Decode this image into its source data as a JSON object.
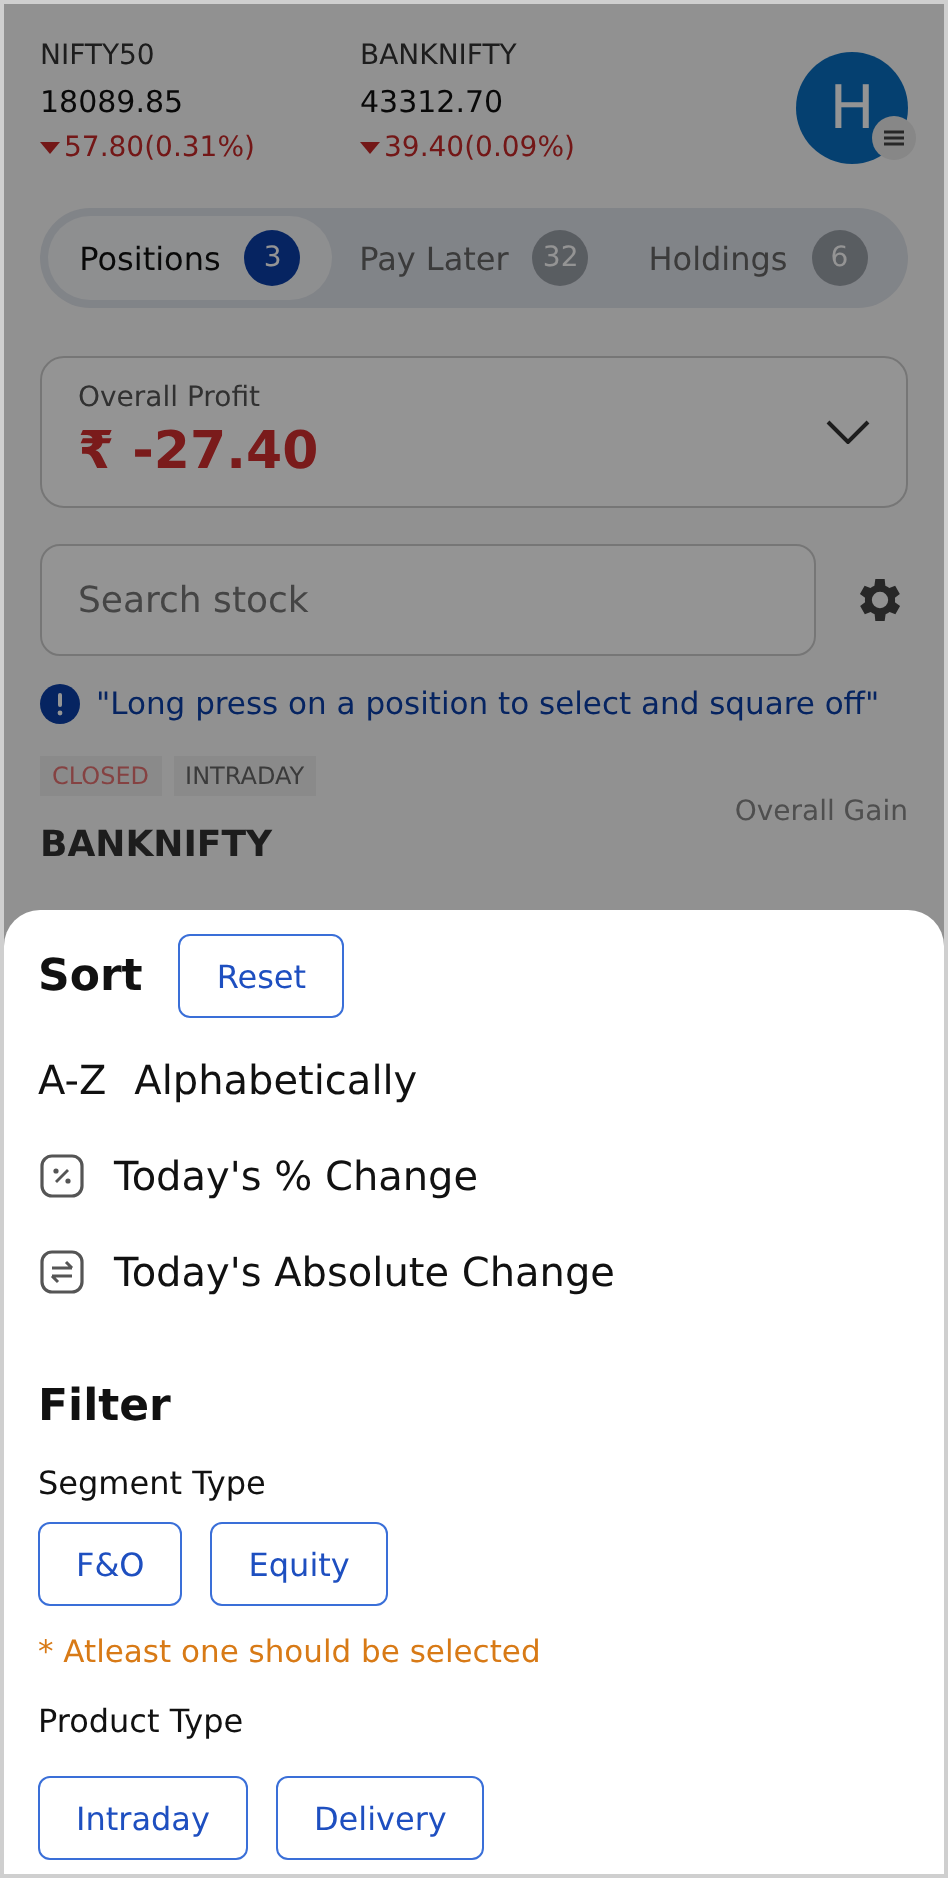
{
  "indices": [
    {
      "name": "NIFTY50",
      "value": "18089.85",
      "change": "57.80(0.31%)",
      "falling": true
    },
    {
      "name": "BANKNIFTY",
      "value": "43312.70",
      "change": "39.40(0.09%)",
      "falling": true
    }
  ],
  "avatar": {
    "initial": "H"
  },
  "tabs": [
    {
      "label": "Positions",
      "count": "3",
      "selected": true
    },
    {
      "label": "Pay Later",
      "count": "32",
      "selected": false
    },
    {
      "label": "Holdings",
      "count": "6",
      "selected": false
    }
  ],
  "overall_profit": {
    "label": "Overall Profit",
    "value": "₹ -27.40",
    "expanded": false
  },
  "search": {
    "placeholder": "Search stock"
  },
  "hint": "\"Long press on a position to select and square off\"",
  "position": {
    "tags": [
      {
        "label": "CLOSED",
        "kind": "status"
      },
      {
        "label": "INTRADAY",
        "kind": "product"
      }
    ],
    "gain_label": "Overall Gain",
    "symbol": "BANKNIFTY"
  },
  "sheet": {
    "sort_title": "Sort",
    "reset": "Reset",
    "sort_options": [
      {
        "kind": "text",
        "prefix": "A-Z",
        "label": "Alphabetically"
      },
      {
        "kind": "percent",
        "label": "Today's % Change"
      },
      {
        "kind": "swap",
        "label": "Today's Absolute Change"
      }
    ],
    "filter_title": "Filter",
    "segment": {
      "label": "Segment Type",
      "options": [
        {
          "label": "F&O",
          "selected": false
        },
        {
          "label": "Equity",
          "selected": false
        }
      ],
      "warning": "* Atleast one should be selected"
    },
    "product": {
      "label": "Product Type",
      "options": [
        {
          "label": "Intraday",
          "selected": false
        },
        {
          "label": "Delivery",
          "selected": false
        }
      ]
    }
  }
}
